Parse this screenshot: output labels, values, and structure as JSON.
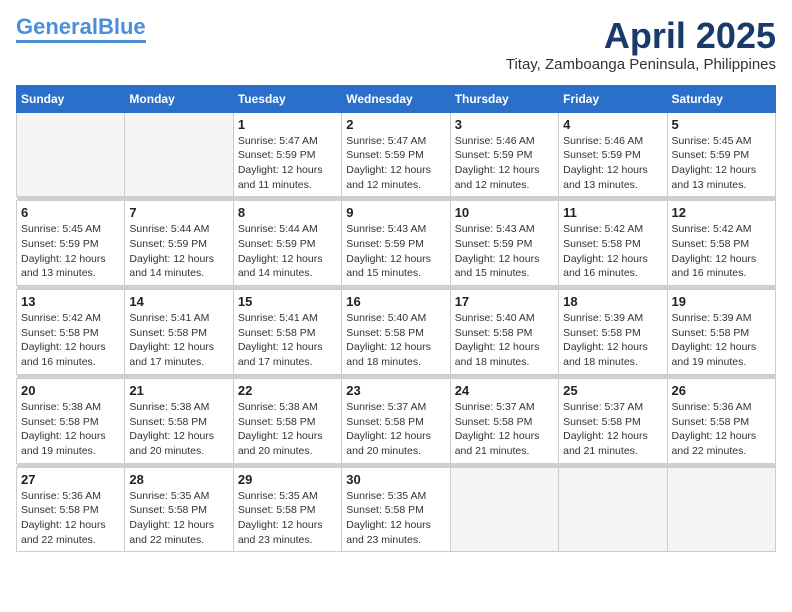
{
  "header": {
    "logo_line1": "General",
    "logo_line2": "Blue",
    "month": "April 2025",
    "location": "Titay, Zamboanga Peninsula, Philippines"
  },
  "weekdays": [
    "Sunday",
    "Monday",
    "Tuesday",
    "Wednesday",
    "Thursday",
    "Friday",
    "Saturday"
  ],
  "weeks": [
    [
      {
        "day": "",
        "info": ""
      },
      {
        "day": "",
        "info": ""
      },
      {
        "day": "1",
        "info": "Sunrise: 5:47 AM\nSunset: 5:59 PM\nDaylight: 12 hours\nand 11 minutes."
      },
      {
        "day": "2",
        "info": "Sunrise: 5:47 AM\nSunset: 5:59 PM\nDaylight: 12 hours\nand 12 minutes."
      },
      {
        "day": "3",
        "info": "Sunrise: 5:46 AM\nSunset: 5:59 PM\nDaylight: 12 hours\nand 12 minutes."
      },
      {
        "day": "4",
        "info": "Sunrise: 5:46 AM\nSunset: 5:59 PM\nDaylight: 12 hours\nand 13 minutes."
      },
      {
        "day": "5",
        "info": "Sunrise: 5:45 AM\nSunset: 5:59 PM\nDaylight: 12 hours\nand 13 minutes."
      }
    ],
    [
      {
        "day": "6",
        "info": "Sunrise: 5:45 AM\nSunset: 5:59 PM\nDaylight: 12 hours\nand 13 minutes."
      },
      {
        "day": "7",
        "info": "Sunrise: 5:44 AM\nSunset: 5:59 PM\nDaylight: 12 hours\nand 14 minutes."
      },
      {
        "day": "8",
        "info": "Sunrise: 5:44 AM\nSunset: 5:59 PM\nDaylight: 12 hours\nand 14 minutes."
      },
      {
        "day": "9",
        "info": "Sunrise: 5:43 AM\nSunset: 5:59 PM\nDaylight: 12 hours\nand 15 minutes."
      },
      {
        "day": "10",
        "info": "Sunrise: 5:43 AM\nSunset: 5:59 PM\nDaylight: 12 hours\nand 15 minutes."
      },
      {
        "day": "11",
        "info": "Sunrise: 5:42 AM\nSunset: 5:58 PM\nDaylight: 12 hours\nand 16 minutes."
      },
      {
        "day": "12",
        "info": "Sunrise: 5:42 AM\nSunset: 5:58 PM\nDaylight: 12 hours\nand 16 minutes."
      }
    ],
    [
      {
        "day": "13",
        "info": "Sunrise: 5:42 AM\nSunset: 5:58 PM\nDaylight: 12 hours\nand 16 minutes."
      },
      {
        "day": "14",
        "info": "Sunrise: 5:41 AM\nSunset: 5:58 PM\nDaylight: 12 hours\nand 17 minutes."
      },
      {
        "day": "15",
        "info": "Sunrise: 5:41 AM\nSunset: 5:58 PM\nDaylight: 12 hours\nand 17 minutes."
      },
      {
        "day": "16",
        "info": "Sunrise: 5:40 AM\nSunset: 5:58 PM\nDaylight: 12 hours\nand 18 minutes."
      },
      {
        "day": "17",
        "info": "Sunrise: 5:40 AM\nSunset: 5:58 PM\nDaylight: 12 hours\nand 18 minutes."
      },
      {
        "day": "18",
        "info": "Sunrise: 5:39 AM\nSunset: 5:58 PM\nDaylight: 12 hours\nand 18 minutes."
      },
      {
        "day": "19",
        "info": "Sunrise: 5:39 AM\nSunset: 5:58 PM\nDaylight: 12 hours\nand 19 minutes."
      }
    ],
    [
      {
        "day": "20",
        "info": "Sunrise: 5:38 AM\nSunset: 5:58 PM\nDaylight: 12 hours\nand 19 minutes."
      },
      {
        "day": "21",
        "info": "Sunrise: 5:38 AM\nSunset: 5:58 PM\nDaylight: 12 hours\nand 20 minutes."
      },
      {
        "day": "22",
        "info": "Sunrise: 5:38 AM\nSunset: 5:58 PM\nDaylight: 12 hours\nand 20 minutes."
      },
      {
        "day": "23",
        "info": "Sunrise: 5:37 AM\nSunset: 5:58 PM\nDaylight: 12 hours\nand 20 minutes."
      },
      {
        "day": "24",
        "info": "Sunrise: 5:37 AM\nSunset: 5:58 PM\nDaylight: 12 hours\nand 21 minutes."
      },
      {
        "day": "25",
        "info": "Sunrise: 5:37 AM\nSunset: 5:58 PM\nDaylight: 12 hours\nand 21 minutes."
      },
      {
        "day": "26",
        "info": "Sunrise: 5:36 AM\nSunset: 5:58 PM\nDaylight: 12 hours\nand 22 minutes."
      }
    ],
    [
      {
        "day": "27",
        "info": "Sunrise: 5:36 AM\nSunset: 5:58 PM\nDaylight: 12 hours\nand 22 minutes."
      },
      {
        "day": "28",
        "info": "Sunrise: 5:35 AM\nSunset: 5:58 PM\nDaylight: 12 hours\nand 22 minutes."
      },
      {
        "day": "29",
        "info": "Sunrise: 5:35 AM\nSunset: 5:58 PM\nDaylight: 12 hours\nand 23 minutes."
      },
      {
        "day": "30",
        "info": "Sunrise: 5:35 AM\nSunset: 5:58 PM\nDaylight: 12 hours\nand 23 minutes."
      },
      {
        "day": "",
        "info": ""
      },
      {
        "day": "",
        "info": ""
      },
      {
        "day": "",
        "info": ""
      }
    ]
  ]
}
